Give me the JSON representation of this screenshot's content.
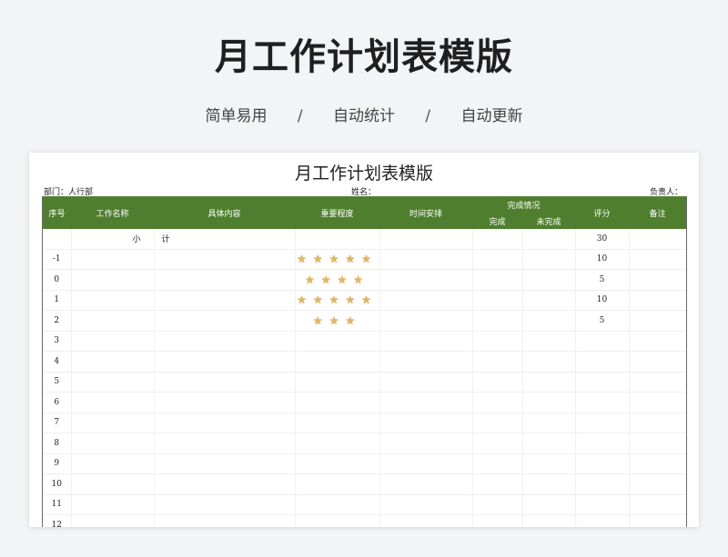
{
  "hero": {
    "title": "月工作计划表模版",
    "features": [
      "简单易用",
      "自动统计",
      "自动更新"
    ],
    "separator": "/"
  },
  "sheet": {
    "title": "月工作计划表模版",
    "department_label": "部门：人行部",
    "name_label": "姓名：",
    "owner_label": "负责人：",
    "header_color": "#4f7f2e",
    "star_color": "#e4b660",
    "columns": {
      "seq": "序号",
      "task": "工作名称",
      "content": "具体内容",
      "importance": "重要程度",
      "schedule": "时间安排",
      "completion": "完成情况",
      "done": "完成",
      "undone": "未完成",
      "score": "评分",
      "remark": "备注"
    },
    "subtotal": {
      "label_a": "小",
      "label_b": "计",
      "score": "30"
    },
    "rows": [
      {
        "seq": "-1",
        "stars": "★★★★★",
        "score": "10"
      },
      {
        "seq": "0",
        "stars": "★★★★",
        "score": "5"
      },
      {
        "seq": "1",
        "stars": "★★★★★",
        "score": "10"
      },
      {
        "seq": "2",
        "stars": "★★★",
        "score": "5"
      },
      {
        "seq": "3",
        "stars": "",
        "score": ""
      },
      {
        "seq": "4",
        "stars": "",
        "score": ""
      },
      {
        "seq": "5",
        "stars": "",
        "score": ""
      },
      {
        "seq": "6",
        "stars": "",
        "score": ""
      },
      {
        "seq": "7",
        "stars": "",
        "score": ""
      },
      {
        "seq": "8",
        "stars": "",
        "score": ""
      },
      {
        "seq": "9",
        "stars": "",
        "score": ""
      },
      {
        "seq": "10",
        "stars": "",
        "score": ""
      },
      {
        "seq": "11",
        "stars": "",
        "score": ""
      },
      {
        "seq": "12",
        "stars": "",
        "score": ""
      }
    ]
  }
}
